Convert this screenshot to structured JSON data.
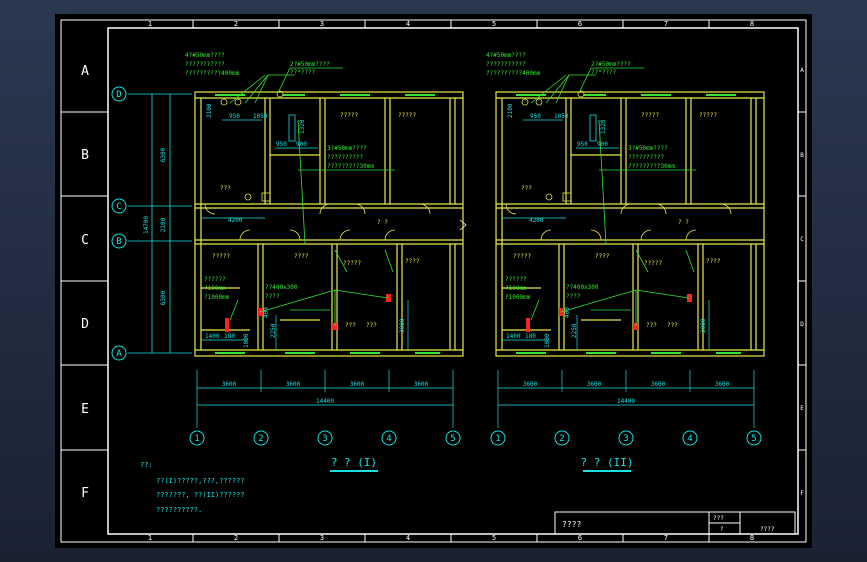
{
  "colors": {
    "frame": "#ffffff",
    "wall": "#e8e84a",
    "dim": "#18e0e0",
    "leader": "#33e633",
    "grid": "#ffffff",
    "accent": "#ff2222",
    "background": "#000000"
  },
  "frame": {
    "col_labels": [
      "1",
      "2",
      "3",
      "4",
      "5",
      "6",
      "7",
      "8"
    ],
    "row_labels": [
      "A",
      "B",
      "C",
      "D",
      "E",
      "F"
    ]
  },
  "axes": {
    "numbers": [
      "1",
      "2",
      "3",
      "4",
      "5"
    ],
    "letters": [
      "D",
      "C",
      "B",
      "A"
    ]
  },
  "plan1": {
    "title": "? ? (I)",
    "note1": "4?#50mm????",
    "note2": "???????????",
    "note3": "??????????400mm",
    "note4": "2?#50mm????",
    "note5": "??*????",
    "note6": "3?#50mm????",
    "note7": "??????????",
    "note8": "?????????30mm",
    "room_a": "?????",
    "room_b": "?????",
    "room_c": "???",
    "room_d": "? ?",
    "room_e": "?????",
    "room_f": "????",
    "room_g": "?????",
    "room_h": "????",
    "room_i": "???",
    "room_j": "???",
    "note9": "??400x300",
    "note10": "????",
    "note11": "??????",
    "note12": "?100mm",
    "note13": "?1000mm",
    "dim_4200": "4200",
    "dim_1400": "1400",
    "dim_180": "180",
    "dim_950a": "950",
    "dim_950b": "950",
    "dim_1050": "1050",
    "dim_1320": "1320",
    "dim_900": "900",
    "dim_2100v": "2100",
    "dim_1000": "1000",
    "dim_2250": "2250",
    "dim_3000": "3000",
    "dim_400": "400",
    "dims_bottom": [
      "3600",
      "3600",
      "3600",
      "3600"
    ],
    "dim_total": "14400"
  },
  "plan2": {
    "title": "? ? (II)",
    "note1": "4?#50mm????",
    "note2": "???????????",
    "note3": "??????????400mm",
    "note4": "2?#50mm????",
    "note5": "??*????",
    "note6": "3?#50mm????",
    "note7": "??????????",
    "note8": "?????????30mm",
    "room_a": "?????",
    "room_b": "?????",
    "room_c": "???",
    "room_d": "? ?",
    "room_e": "?????",
    "room_f": "????",
    "room_g": "?????",
    "room_h": "????",
    "room_i": "???",
    "room_j": "???",
    "note9": "??400x300",
    "note10": "????",
    "note11": "??????",
    "note12": "?100mm",
    "note13": "?1000mm",
    "dim_4200": "4200",
    "dim_1400": "1400",
    "dim_180": "180",
    "dim_950a": "950",
    "dim_950b": "950",
    "dim_1050": "1050",
    "dim_1320": "1320",
    "dim_900": "900",
    "dim_2100v": "2100",
    "dim_1000": "1000",
    "dim_2250": "2250",
    "dim_3000": "3000",
    "dim_400": "400",
    "dims_bottom": [
      "3600",
      "3600",
      "3600",
      "3600"
    ],
    "dim_total": "14400"
  },
  "left_dims": {
    "d1": "6300",
    "d2": "2100",
    "d3": "6300",
    "total": "14700"
  },
  "notes": {
    "heading": "??:",
    "line1": "??(I)?????,???,??????",
    "line2": "???????, ??(II)??????",
    "line3": "??????????."
  },
  "title_block": {
    "name": "????",
    "cell1": "???",
    "cell2": "?",
    "cell3": "????"
  }
}
